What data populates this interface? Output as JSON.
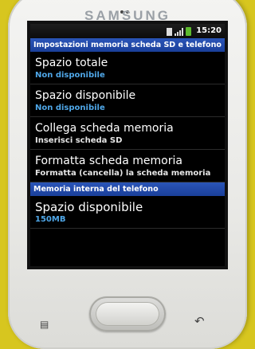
{
  "device": {
    "brand": "SAMSUNG"
  },
  "statusbar": {
    "time": "15:20"
  },
  "sd_section": {
    "header": "Impostazioni memoria scheda SD e telefono",
    "items": [
      {
        "title": "Spazio totale",
        "subtitle": "Non disponibile"
      },
      {
        "title": "Spazio disponibile",
        "subtitle": "Non disponibile"
      },
      {
        "title": "Collega scheda memoria",
        "subtitle": "Inserisci scheda SD"
      },
      {
        "title": "Formatta scheda memoria",
        "subtitle": "Formatta (cancella) la scheda memoria"
      }
    ]
  },
  "internal_section": {
    "header": "Memoria interna del telefono",
    "items": [
      {
        "title": "Spazio disponibile",
        "subtitle": "150MB"
      }
    ]
  },
  "keys": {
    "menu_icon": "menu-icon",
    "back_icon": "back-icon"
  }
}
